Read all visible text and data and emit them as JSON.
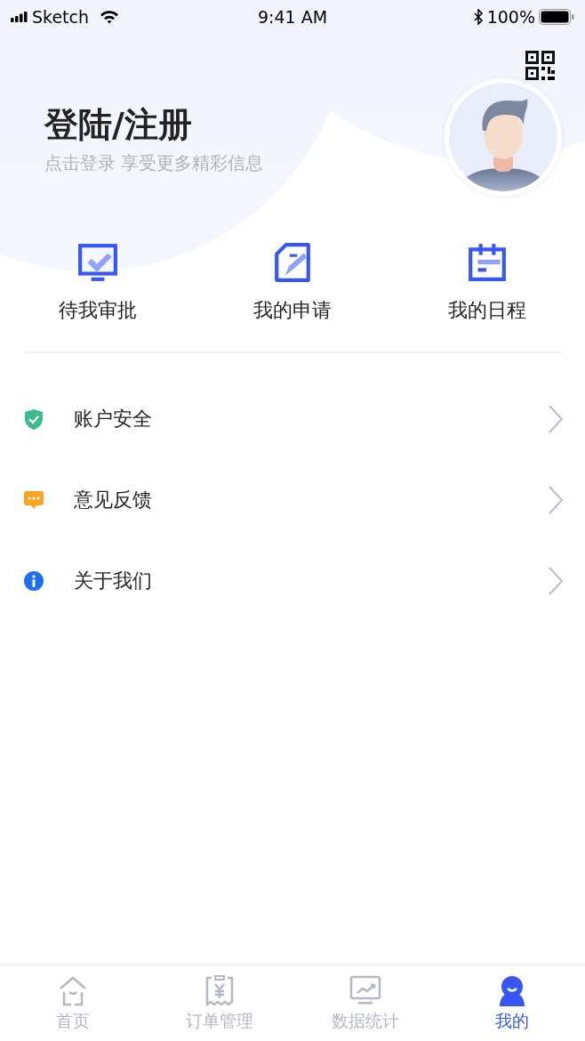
{
  "status_bar": {
    "carrier": "Sketch",
    "time": "9:41 AM",
    "battery": "100%"
  },
  "profile": {
    "title": "登陆/注册",
    "subtitle": "点击登录 享受更多精彩信息"
  },
  "shortcuts": [
    {
      "kind": "approval",
      "label": "待我审批"
    },
    {
      "kind": "application",
      "label": "我的申请"
    },
    {
      "kind": "schedule",
      "label": "我的日程"
    }
  ],
  "menu": [
    {
      "kind": "security",
      "label": "账户安全",
      "color": "#3dbb8c"
    },
    {
      "kind": "feedback",
      "label": "意见反馈",
      "color": "#ffa41f"
    },
    {
      "kind": "about",
      "label": "关于我们",
      "color": "#1f6ff2"
    }
  ],
  "tabs": [
    {
      "kind": "home",
      "label": "首页",
      "selected": false
    },
    {
      "kind": "orders",
      "label": "订单管理",
      "selected": false
    },
    {
      "kind": "stats",
      "label": "数据统计",
      "selected": false
    },
    {
      "kind": "me",
      "label": "我的",
      "selected": true
    }
  ]
}
